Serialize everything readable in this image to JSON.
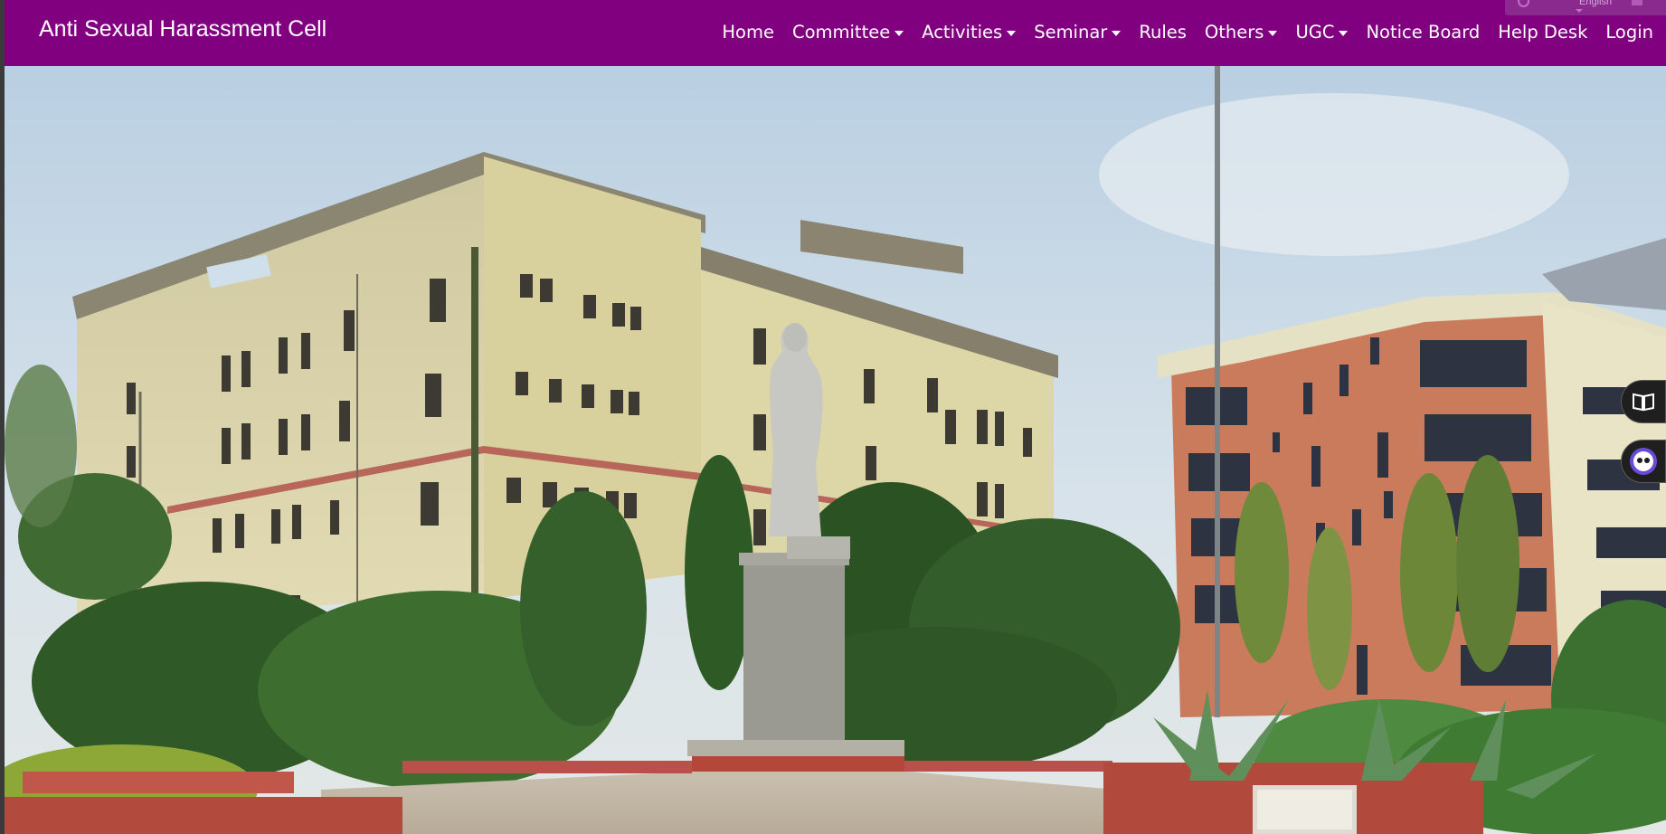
{
  "site": {
    "brand": "Anti Sexual Harassment Cell"
  },
  "nav": {
    "items": [
      {
        "label": "Home",
        "dropdown": false
      },
      {
        "label": "Committee",
        "dropdown": true
      },
      {
        "label": "Activities",
        "dropdown": true
      },
      {
        "label": "Seminar",
        "dropdown": true
      },
      {
        "label": "Rules",
        "dropdown": false
      },
      {
        "label": "Others",
        "dropdown": true
      },
      {
        "label": "UGC",
        "dropdown": true
      },
      {
        "label": "Notice Board",
        "dropdown": false
      },
      {
        "label": "Help Desk",
        "dropdown": false
      },
      {
        "label": "Login",
        "dropdown": false
      }
    ]
  },
  "language_widget": {
    "label": "English"
  },
  "hero": {
    "icons": [
      "book-icon",
      "chatbot-icon"
    ]
  },
  "colors": {
    "navbar": "#800080",
    "sky": "#c9dbe9",
    "building_left": "#ddd6a8",
    "building_right": "#c97b5c"
  }
}
